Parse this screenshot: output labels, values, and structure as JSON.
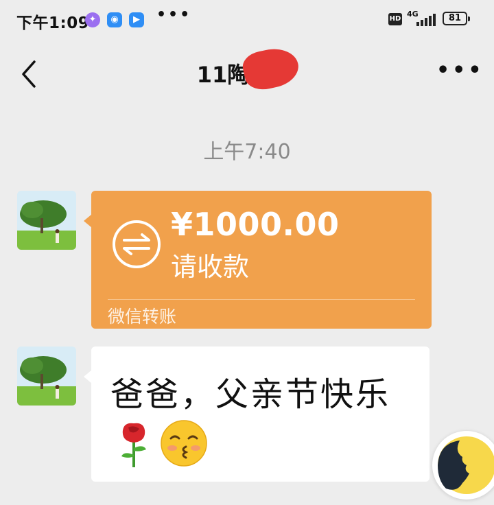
{
  "status_bar": {
    "time": "下午1:09",
    "more": "•••",
    "hd": "HD",
    "network": "4G",
    "battery": "81"
  },
  "nav": {
    "title": "11陶",
    "back_icon": "chevron-left-icon",
    "menu": "•••"
  },
  "chat": {
    "timestamp": "上午7:40",
    "transfer": {
      "amount": "¥1000.00",
      "status": "请收款",
      "footer": "微信转账",
      "icon": "transfer-arrows-icon",
      "color": "#f1a14c"
    },
    "message": {
      "text": "爸爸，父亲节快乐",
      "emojis": [
        "rose-icon",
        "kissing-face-icon"
      ]
    }
  },
  "colors": {
    "background": "#ededed",
    "transfer": "#f1a14c",
    "timestamp": "#8a8a8a"
  }
}
